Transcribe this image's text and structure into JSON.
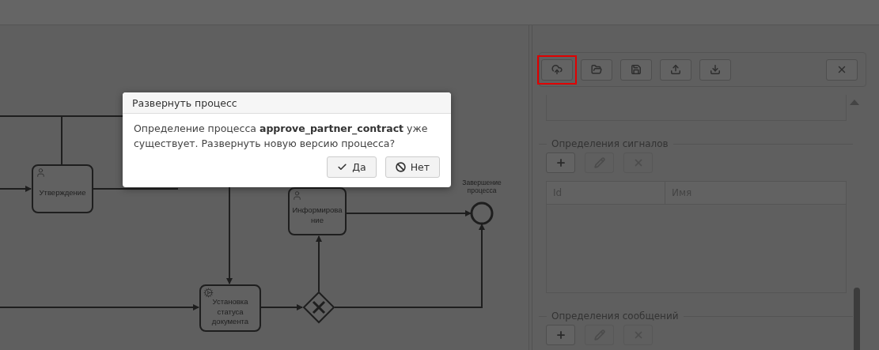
{
  "diagram": {
    "nodes": [
      {
        "kind": "user_task",
        "label": "Утверждение"
      },
      {
        "kind": "user_task",
        "label": "Информирование"
      },
      {
        "kind": "service_task",
        "label": "Установка статуса документа"
      }
    ],
    "end_event": {
      "label": "Завершение процесса"
    }
  },
  "dialog": {
    "title": "Развернуть процесс",
    "message": "Определение процесса **approve_partner_contract** уже существует. Развернуть новую версию процесса?",
    "buttons": [
      {
        "kind": "confirm",
        "label": "Да"
      },
      {
        "kind": "cancel",
        "label": "Нет"
      }
    ]
  },
  "toolbar": {
    "buttons": [
      {
        "kind": "deploy",
        "highlighted": true
      },
      {
        "kind": "open",
        "highlighted": false
      },
      {
        "kind": "save",
        "highlighted": false
      },
      {
        "kind": "upload",
        "highlighted": false
      },
      {
        "kind": "download",
        "highlighted": false
      },
      {
        "kind": "close",
        "highlighted": false
      }
    ]
  },
  "sections": [
    {
      "title": "Определения сигналов",
      "buttons": [
        {
          "kind": "add",
          "disabled": false
        },
        {
          "kind": "edit",
          "disabled": true
        },
        {
          "kind": "delete",
          "disabled": true
        }
      ],
      "table": {
        "columns": [
          "Id",
          "Имя"
        ]
      }
    },
    {
      "title": "Определения сообщений",
      "buttons": [
        {
          "kind": "add",
          "disabled": false
        },
        {
          "kind": "edit",
          "disabled": true
        },
        {
          "kind": "delete",
          "disabled": true
        }
      ]
    }
  ]
}
